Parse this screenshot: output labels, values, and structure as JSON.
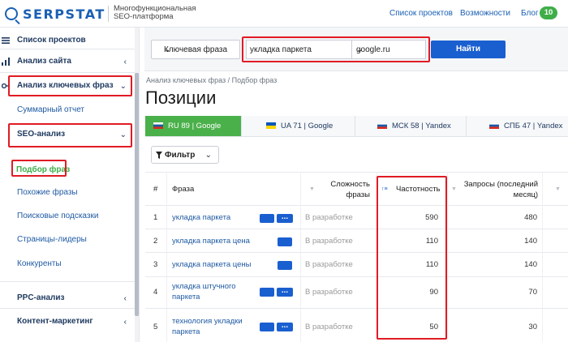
{
  "header": {
    "brand": "SERPSTAT",
    "tagline": "Многофункциональная SEO-платформа",
    "nav": [
      "Список проектов",
      "Возможности",
      "Блог"
    ],
    "blog_count": "10"
  },
  "sidebar": {
    "items": [
      {
        "label": "Список проектов",
        "icon": "menu-icon"
      },
      {
        "label": "Анализ сайта",
        "icon": "bar-chart-icon",
        "chevron": "‹"
      },
      {
        "label": "Анализ ключевых фраз",
        "icon": "key-icon",
        "chevron": "⌄"
      },
      {
        "label": "Суммарный отчет"
      },
      {
        "label": "SEO-анализ",
        "chevron": "⌄"
      },
      {
        "label": "Подбор фраз"
      },
      {
        "label": "Похожие фразы"
      },
      {
        "label": "Поисковые подсказки"
      },
      {
        "label": "Страницы-лидеры"
      },
      {
        "label": "Конкуренты"
      },
      {
        "label": "PPC-анализ",
        "chevron": "‹"
      },
      {
        "label": "Контент-маркетинг",
        "chevron": "‹"
      }
    ]
  },
  "search": {
    "type_label": "Ключевая фраза",
    "query": "укладка паркета",
    "database": "google.ru",
    "button": "Найти"
  },
  "breadcrumb": "Анализ ключевых фраз / Подбор фраз",
  "title": "Позиции",
  "tabs": [
    {
      "label": "RU 89 | Google",
      "flag": "ru"
    },
    {
      "label": "UA 71 | Google",
      "flag": "ua"
    },
    {
      "label": "МСК 58 | Yandex",
      "flag": "ru"
    },
    {
      "label": "СПБ 47 | Yandex",
      "flag": "ru"
    }
  ],
  "filter_label": "Фильтр",
  "table": {
    "headers": [
      "#",
      "Фраза",
      "Сложность фразы",
      "Частотность",
      "Запросы (последний месяц)"
    ],
    "rows": [
      {
        "n": "1",
        "phrase": "укладка паркета",
        "status": "В разработке",
        "freq": "590",
        "queries": "480"
      },
      {
        "n": "2",
        "phrase": "укладка паркета цена",
        "status": "В разработке",
        "freq": "110",
        "queries": "140"
      },
      {
        "n": "3",
        "phrase": "укладка паркета цены",
        "status": "В разработке",
        "freq": "110",
        "queries": "140"
      },
      {
        "n": "4",
        "phrase": "укладка штучного паркета",
        "status": "В разработке",
        "freq": "90",
        "queries": "70"
      },
      {
        "n": "5",
        "phrase": "технология укладки паркета",
        "status": "В разработке",
        "freq": "50",
        "queries": "30"
      }
    ]
  },
  "colors": {
    "accent": "#1a5fd0",
    "active_tab": "#4ab04a",
    "highlight": "#e01b24",
    "brand": "#1a5fb4"
  }
}
